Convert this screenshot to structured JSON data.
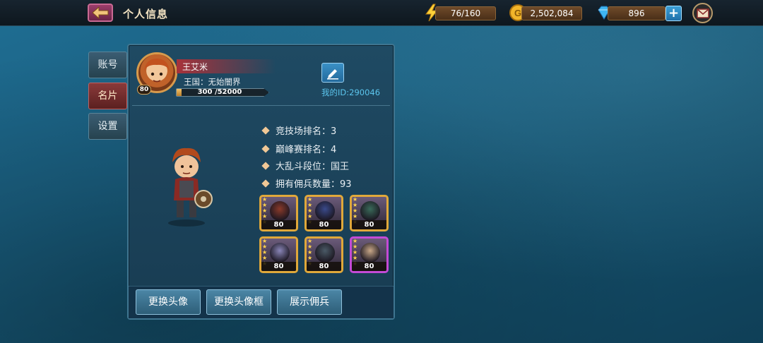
{
  "header": {
    "title": "个人信息",
    "stamina": "76/160",
    "gold": "2,502,084",
    "diamonds": "896",
    "plus_label": "+"
  },
  "tabs": [
    {
      "label": "账号",
      "active": false
    },
    {
      "label": "名片",
      "active": true
    },
    {
      "label": "设置",
      "active": false
    }
  ],
  "profile": {
    "name": "王艾米",
    "kingdom": "王国：无始闇界",
    "level": "80",
    "exp_text": "300 /52000",
    "exp_fraction": 0.006,
    "player_id": "我的ID:290046"
  },
  "stats": [
    "竞技场排名：3",
    "巅峰赛排名：4",
    "大乱斗段位：国王",
    "拥有佣兵数量：93"
  ],
  "mercenaries": [
    {
      "level": "80",
      "stars": 5,
      "frame": "gold",
      "color": "#8a3a2a"
    },
    {
      "level": "80",
      "stars": 5,
      "frame": "gold",
      "color": "#3a4a8a"
    },
    {
      "level": "80",
      "stars": 5,
      "frame": "gold",
      "color": "#3a6a5a"
    },
    {
      "level": "80",
      "stars": 5,
      "frame": "gold",
      "color": "#8a86b8"
    },
    {
      "level": "80",
      "stars": 5,
      "frame": "gold",
      "color": "#4a5a66"
    },
    {
      "level": "80",
      "stars": 5,
      "frame": "purple",
      "color": "#c9a888"
    }
  ],
  "buttons": {
    "change_avatar": "更换头像",
    "change_frame": "更换头像框",
    "show_mercs": "展示佣兵"
  },
  "colors": {
    "accent_blue": "#5cc6ee",
    "tab_active": "#8a3a3a",
    "gold_frame": "#e0a83a",
    "purple_frame": "#c44ad6"
  }
}
